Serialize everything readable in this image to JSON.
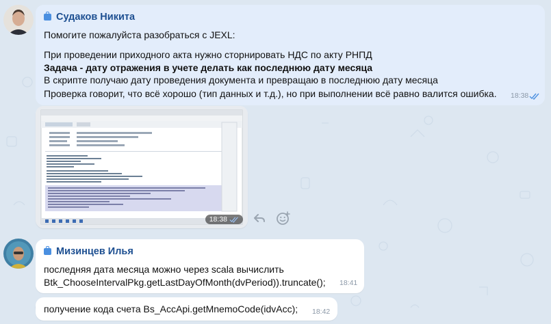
{
  "messages": [
    {
      "sender": "Судаков Никита",
      "lines": [
        "Помогите пожалуйста разобраться с JEXL:",
        "",
        "При проведении приходного акта нужно сторнировать НДС по акту РНПД",
        "Задача - дату отражения в учете делать как последнюю дату месяца",
        "В скрипте получаю дату проведения документа и превращаю в последнюю дату месяца",
        "Проверка говорит, что всё хорошо (тип данных и т.д.), но при выполнении всё равно валится ошибка."
      ],
      "time": "18:38"
    },
    {
      "image_time": "18:38"
    },
    {
      "sender": "Мизинцев Илья",
      "lines": [
        "последняя дата месяца можно через scala вычислить",
        "Btk_ChooseIntervalPkg.getLastDayOfMonth(dvPeriod)).truncate();"
      ],
      "time": "18:41"
    },
    {
      "lines": [
        "получение кода счета Bs_AccApi.getMnemoCode(idvAcc);"
      ],
      "time": "18:42"
    }
  ],
  "colors": {
    "background": "#dde7f1",
    "own_bubble": "#e3edfb",
    "other_bubble": "#ffffff",
    "sender_name": "#1d4f91",
    "read_check": "#4a8fe0"
  },
  "icons": [
    "reply-icon",
    "emoji-reaction-icon",
    "read-check-icon",
    "sender-badge-icon"
  ]
}
